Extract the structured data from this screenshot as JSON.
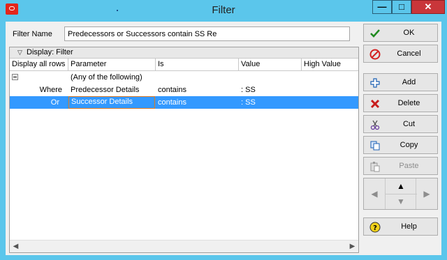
{
  "window": {
    "title": "Filter",
    "controls": {
      "minimize": "—",
      "maximize": "□",
      "close": "✕"
    },
    "colors": {
      "frame": "#5bc6eb",
      "close": "#c9363a",
      "selection": "#3399ff",
      "edit_border": "#e07a1f"
    }
  },
  "filter_name": {
    "label": "Filter Name",
    "value": "Predecessors or Successors contain SS Re"
  },
  "grid": {
    "group_label": "Display: Filter",
    "columns": [
      "Display all rows",
      "Parameter",
      "Is",
      "Value",
      "High Value"
    ],
    "group_row": {
      "parameter": "(Any of the following)"
    },
    "rows": [
      {
        "display": "Where",
        "parameter": "Predecessor Details",
        "is": "contains",
        "value": ": SS",
        "high": ""
      },
      {
        "display": "Or",
        "parameter": "Successor Details",
        "is": "contains",
        "value": ": SS",
        "high": "",
        "selected": true
      }
    ]
  },
  "buttons": {
    "ok": "OK",
    "cancel": "Cancel",
    "add": "Add",
    "delete": "Delete",
    "cut": "Cut",
    "copy": "Copy",
    "paste": "Paste",
    "help": "Help"
  },
  "nav": {
    "up": "▲",
    "down": "▼",
    "left": "◀",
    "right": "▶"
  },
  "scroll": {
    "left": "◀",
    "right": "▶"
  }
}
